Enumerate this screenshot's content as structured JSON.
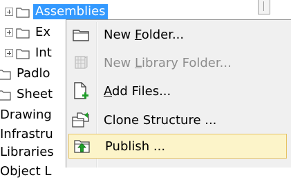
{
  "tree": {
    "items": [
      {
        "label": "Assemblies",
        "selected": true,
        "expandable": true,
        "icon": "folder-icon"
      },
      {
        "label": "Ex",
        "expandable": true,
        "icon": "folder-icon"
      },
      {
        "label": "Int",
        "expandable": true,
        "icon": "folder-icon"
      },
      {
        "label": "Padlo",
        "expandable": false,
        "icon": "folder-icon"
      },
      {
        "label": "Sheet",
        "expandable": false,
        "icon": "folder-icon"
      },
      {
        "label": "Drawing"
      },
      {
        "label": "Infrastru"
      },
      {
        "label": "Libraries"
      },
      {
        "label": "Object L"
      }
    ]
  },
  "context_menu": {
    "items": [
      {
        "pre": "New ",
        "key": "F",
        "post": "older...",
        "icon": "new-folder-icon",
        "enabled": true,
        "highlighted": false
      },
      {
        "pre": "New ",
        "key": "L",
        "post": "ibrary Folder...",
        "icon": "new-library-folder-icon",
        "enabled": false,
        "highlighted": false
      },
      {
        "pre": "",
        "key": "A",
        "post": "dd Files...",
        "icon": "add-files-icon",
        "enabled": true,
        "highlighted": false
      },
      {
        "pre": "Clone Structure ...",
        "key": "",
        "post": "",
        "icon": "clone-structure-icon",
        "enabled": true,
        "highlighted": false
      },
      {
        "pre": "Publish ...",
        "key": "",
        "post": "",
        "icon": "publish-icon",
        "enabled": true,
        "highlighted": true
      }
    ]
  },
  "colors": {
    "selection": "#3399ff",
    "menu_background": "#f0f0f0",
    "menu_highlight": "#fcf4c9",
    "menu_highlight_border": "#e5c365",
    "disabled_text": "#8d8d8d"
  }
}
